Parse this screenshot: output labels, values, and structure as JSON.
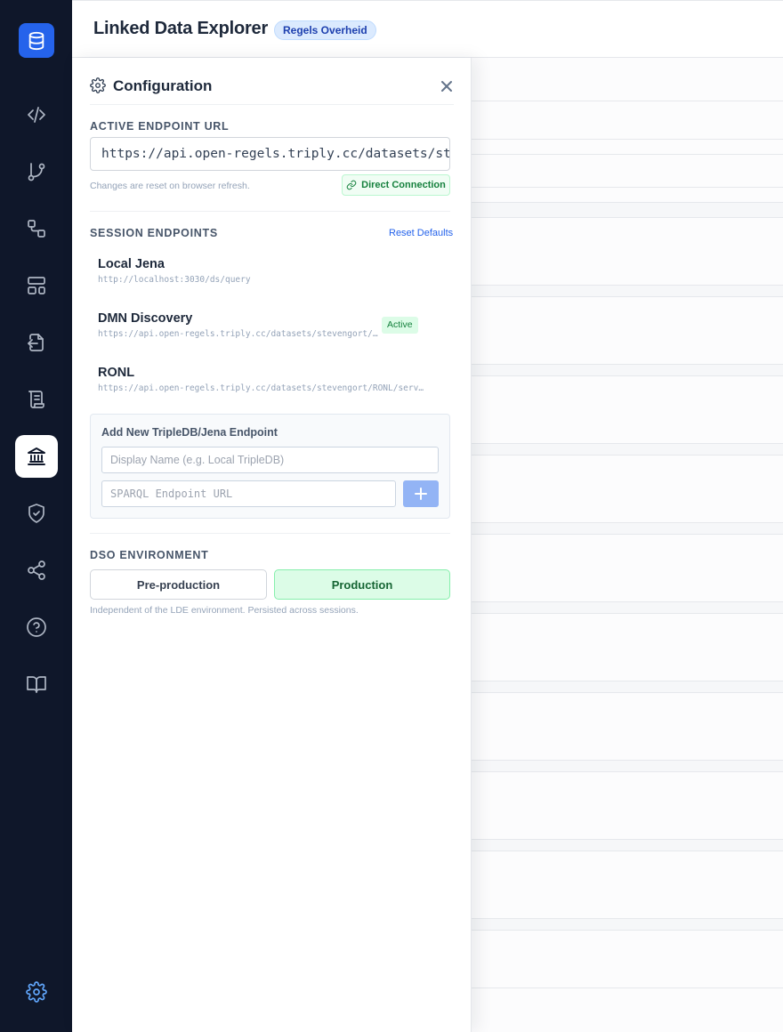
{
  "header": {
    "title": "Linked Data Explorer",
    "badge": "Regels Overheid"
  },
  "sidebar": {
    "logo_icon": "database-icon",
    "items": [
      {
        "icon": "code-icon"
      },
      {
        "icon": "git-branch-icon"
      },
      {
        "icon": "workflow-icon"
      },
      {
        "icon": "layout-icon"
      },
      {
        "icon": "file-import-icon"
      },
      {
        "icon": "scroll-icon"
      },
      {
        "icon": "landmark-icon",
        "active": true
      },
      {
        "icon": "shield-check-icon"
      },
      {
        "icon": "share-icon"
      },
      {
        "icon": "help-circle-icon"
      },
      {
        "icon": "book-open-icon"
      }
    ],
    "settings_icon": "gear-icon"
  },
  "config": {
    "title": "Configuration",
    "active_endpoint_label": "Active Endpoint URL",
    "active_endpoint_value": "https://api.open-regels.triply.cc/datasets/stevengort/DMN-discovery/services/DMN-discovery/sparql",
    "reset_hint": "Changes are reset on browser refresh.",
    "direct_connection": "Direct Connection",
    "session_label": "Session Endpoints",
    "reset_defaults": "Reset Defaults",
    "endpoints": [
      {
        "name": "Local Jena",
        "url": "http://localhost:3030/ds/query"
      },
      {
        "name": "DMN Discovery",
        "url": "https://api.open-regels.triply.cc/datasets/stevengort/DMN-discovery/services/DMN-discovery/sparql",
        "active": true
      },
      {
        "name": "RONL",
        "url": "https://api.open-regels.triply.cc/datasets/stevengort/RONL/services/RONL/sparql"
      }
    ],
    "active_badge": "Active",
    "add": {
      "title": "Add New TripleDB/Jena Endpoint",
      "name_placeholder": "Display Name (e.g. Local TripleDB)",
      "url_placeholder": "SPARQL Endpoint URL"
    },
    "dso_label": "DSO Environment",
    "dso_options": [
      "Pre-production",
      "Production"
    ],
    "dso_selected": "Production",
    "dso_hint": "Independent of the LDE environment. Persisted across sessions."
  },
  "colors": {
    "sidebar_bg": "#0f172a",
    "accent": "#2563eb",
    "success": "#15803d"
  }
}
